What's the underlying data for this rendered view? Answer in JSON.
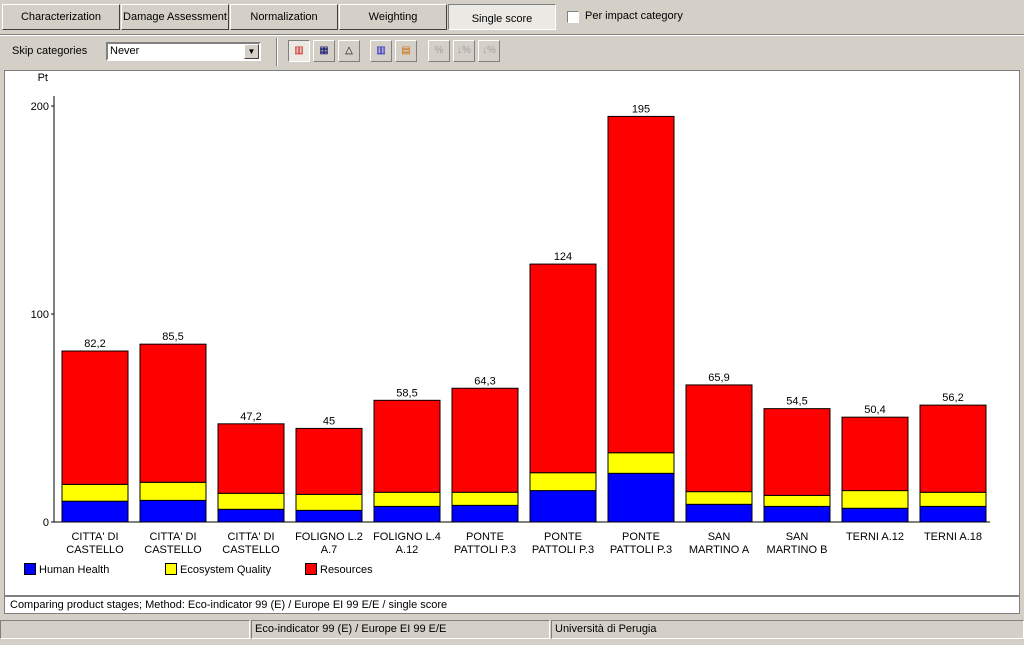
{
  "tabs": [
    "Characterization",
    "Damage Assessment",
    "Normalization",
    "Weighting",
    "Single score"
  ],
  "per_impact_category": "Per impact category",
  "skip_label": "Skip categories",
  "skip_value": "Never",
  "toolbar_icons": [
    "bar-chart-icon",
    "table-icon",
    "triangle-chart-icon",
    "grouped-bar-icon",
    "stacked-chart-icon",
    "percent-icon",
    "sort-percent-desc-icon",
    "sort-percent-asc-icon"
  ],
  "caption": "Comparing product stages;  Method: Eco-indicator 99 (E) /  Europe EI 99 E/E / single score",
  "status": [
    "",
    "Eco-indicator 99 (E) /  Europe EI 99 E/E",
    "Università di Perugia"
  ],
  "chart_data": {
    "type": "bar",
    "stacked": true,
    "ylabel": "Pt",
    "ylim": [
      0,
      200
    ],
    "yticks": [
      0,
      100,
      200
    ],
    "grid": false,
    "legend": "bottom-left",
    "categories": [
      [
        "CITTA' DI",
        "CASTELLO"
      ],
      [
        "CITTA' DI",
        "CASTELLO"
      ],
      [
        "CITTA' DI",
        "CASTELLO"
      ],
      [
        "FOLIGNO L.2",
        "A.7"
      ],
      [
        "FOLIGNO L.4",
        "A.12"
      ],
      [
        "PONTE",
        "PATTOLI P.3"
      ],
      [
        "PONTE",
        "PATTOLI P.3"
      ],
      [
        "PONTE",
        "PATTOLI P.3"
      ],
      [
        "SAN",
        "MARTINO A"
      ],
      [
        "SAN",
        "MARTINO B"
      ],
      [
        "TERNI A.12",
        ""
      ],
      [
        "TERNI A.18",
        ""
      ]
    ],
    "total_labels": [
      "82,2",
      "85,5",
      "47,2",
      "45",
      "58,5",
      "64,3",
      "124",
      "195",
      "65,9",
      "54,5",
      "50,4",
      "56,2"
    ],
    "totals": [
      82.2,
      85.5,
      47.2,
      45,
      58.5,
      64.3,
      124,
      195,
      65.9,
      54.5,
      50.4,
      56.2
    ],
    "series": [
      {
        "name": "Human Health",
        "color": "#0000ff",
        "values": [
          10.0,
          10.4,
          6.1,
          5.6,
          7.5,
          8.0,
          15.1,
          23.4,
          8.5,
          7.5,
          6.6,
          7.5
        ]
      },
      {
        "name": "Ecosystem Quality",
        "color": "#ffff00",
        "values": [
          8.1,
          8.7,
          7.7,
          7.7,
          6.8,
          6.3,
          8.6,
          9.9,
          6.1,
          5.3,
          8.5,
          6.8
        ]
      },
      {
        "name": "Resources",
        "color": "#ff0000",
        "values": [
          64.1,
          66.4,
          33.4,
          31.7,
          44.2,
          50.0,
          100.3,
          161.7,
          51.3,
          41.7,
          35.3,
          41.9
        ]
      }
    ]
  }
}
